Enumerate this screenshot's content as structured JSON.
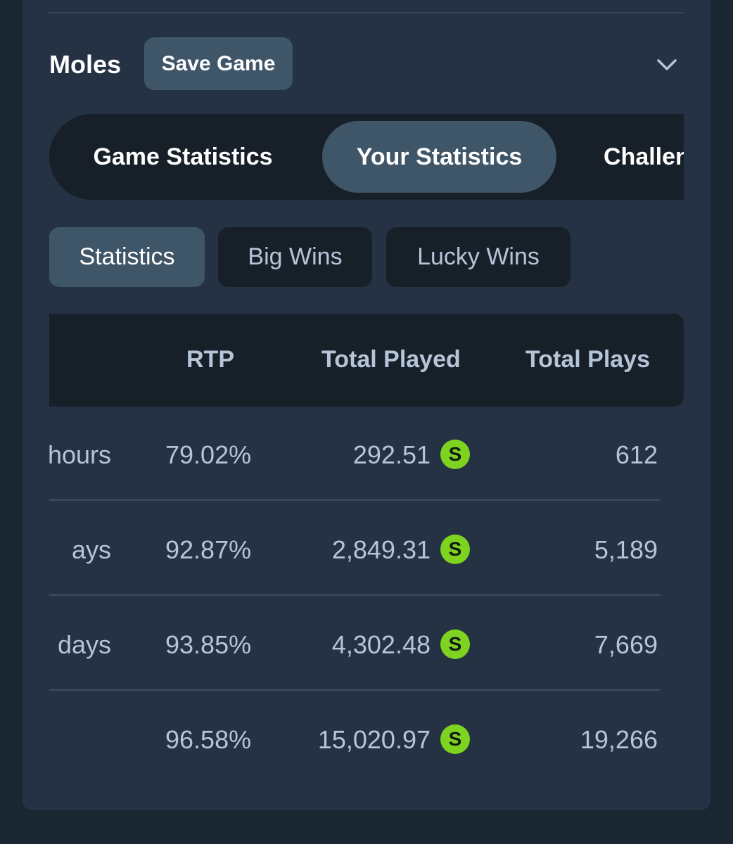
{
  "header": {
    "title": "Moles",
    "save_label": "Save Game"
  },
  "tabs": [
    {
      "label": "Game Statistics"
    },
    {
      "label": "Your Statistics",
      "active": true
    },
    {
      "label": "Challenges"
    }
  ],
  "subtabs": [
    {
      "label": "Statistics",
      "active": true
    },
    {
      "label": "Big Wins"
    },
    {
      "label": "Lucky Wins"
    }
  ],
  "table": {
    "headers": {
      "rtp": "RTP",
      "total_played": "Total Played",
      "total_plays": "Total Plays"
    },
    "rows": [
      {
        "period": "hours",
        "rtp": "79.02%",
        "total_played": "292.51",
        "total_plays": "612"
      },
      {
        "period": "ays",
        "rtp": "92.87%",
        "total_played": "2,849.31",
        "total_plays": "5,189"
      },
      {
        "period": "days",
        "rtp": "93.85%",
        "total_played": "4,302.48",
        "total_plays": "7,669"
      },
      {
        "period": "",
        "rtp": "96.58%",
        "total_played": "15,020.97",
        "total_plays": "19,266"
      }
    ],
    "currency_symbol": "S"
  },
  "colors": {
    "background": "#1b2633",
    "panel": "#243243",
    "active_pill": "#3f5568",
    "dark_pill": "#172029",
    "currency": "#7ed321",
    "muted_text": "#b5c5d7"
  },
  "icons": {
    "chevron": "chevron-down-icon",
    "currency": "coin-s-icon"
  }
}
